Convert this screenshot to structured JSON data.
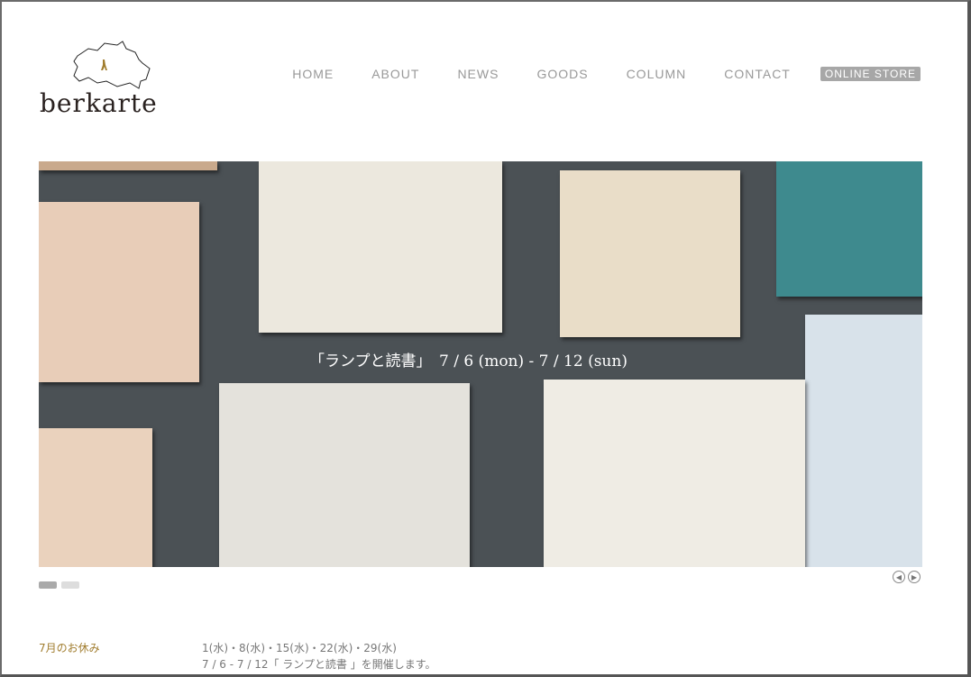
{
  "brand": {
    "name": "berkarte"
  },
  "nav": {
    "items": [
      "HOME",
      "ABOUT",
      "NEWS",
      "GOODS",
      "COLUMN",
      "CONTACT"
    ],
    "store_label": "ONLINE STORE"
  },
  "slider": {
    "caption": "「ランプと読書」　7 / 6 (mon) - 7 / 12 (sun)",
    "active_index": 0,
    "total": 2,
    "prev_icon": "chevron-left-icon",
    "next_icon": "chevron-right-icon"
  },
  "notice": {
    "label": "7月のお休み",
    "lines": [
      "1(水)・8(水)・15(水)・22(水)・29(水)",
      "7 / 6 - 7 / 12「 ランプと読書 」を開催します。"
    ]
  },
  "colors": {
    "accent": "#a17d2f",
    "nav": "#999999",
    "store_bg": "#a7a7a7"
  }
}
